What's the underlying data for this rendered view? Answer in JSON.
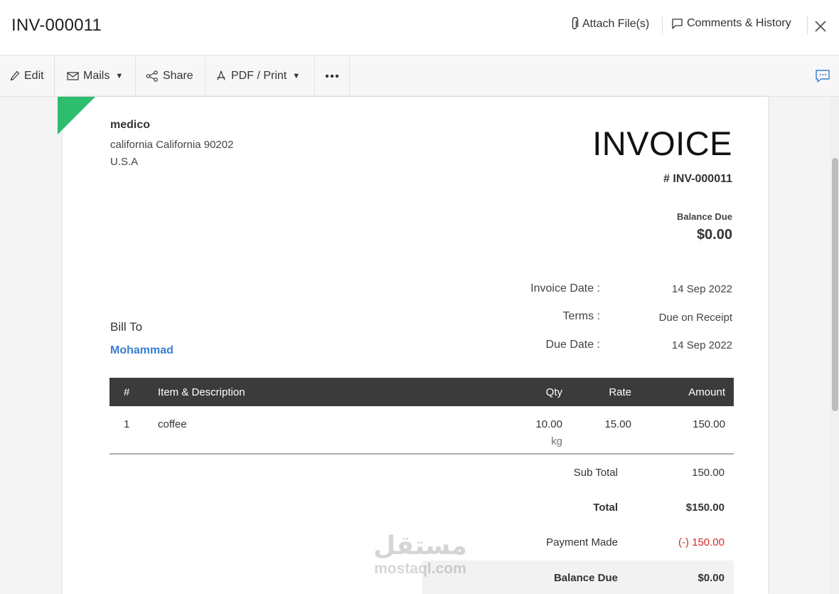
{
  "header": {
    "title": "INV-000011",
    "attach_label": "Attach File(s)",
    "comments_label": "Comments & History"
  },
  "toolbar": {
    "edit_label": "Edit",
    "mails_label": "Mails",
    "share_label": "Share",
    "pdf_label": "PDF / Print"
  },
  "org": {
    "name": "medico",
    "line1": "california  California 90202",
    "line2": "U.S.A"
  },
  "invoice": {
    "heading": "INVOICE",
    "number": "# INV-000011",
    "balance_label": "Balance Due",
    "balance_value": "$0.00",
    "meta": {
      "date_label": "Invoice Date :",
      "date_value": "14 Sep 2022",
      "terms_label": "Terms :",
      "terms_value": "Due on Receipt",
      "due_label": "Due Date :",
      "due_value": "14 Sep 2022"
    },
    "bill_to_label": "Bill To",
    "bill_to_name": "Mohammad"
  },
  "table": {
    "headers": [
      "#",
      "Item & Description",
      "Qty",
      "Rate",
      "Amount"
    ],
    "rows": [
      {
        "num": "1",
        "item": "coffee",
        "qty": "10.00",
        "unit": "kg",
        "rate": "15.00",
        "amount": "150.00"
      }
    ]
  },
  "totals": {
    "subtotal_label": "Sub Total",
    "subtotal_value": "150.00",
    "total_label": "Total",
    "total_value": "$150.00",
    "payment_label": "Payment Made",
    "payment_value": "(-) 150.00",
    "balance_label": "Balance Due",
    "balance_value": "$0.00"
  },
  "watermark": {
    "arabic": "مستقل",
    "latin": "mostaql.com"
  },
  "colors": {
    "ribbon": "#2dbd6e",
    "link": "#3b7ed1",
    "table_header": "#3b3b3b",
    "negative": "#d12a2a"
  },
  "icons": {
    "attach": "paperclip-icon",
    "comments": "comment-icon",
    "close": "close-icon",
    "edit": "pencil-icon",
    "mails": "envelope-icon",
    "share": "share-icon",
    "pdf": "pdf-icon",
    "more": "more-dots-icon",
    "chat": "chat-icon"
  }
}
